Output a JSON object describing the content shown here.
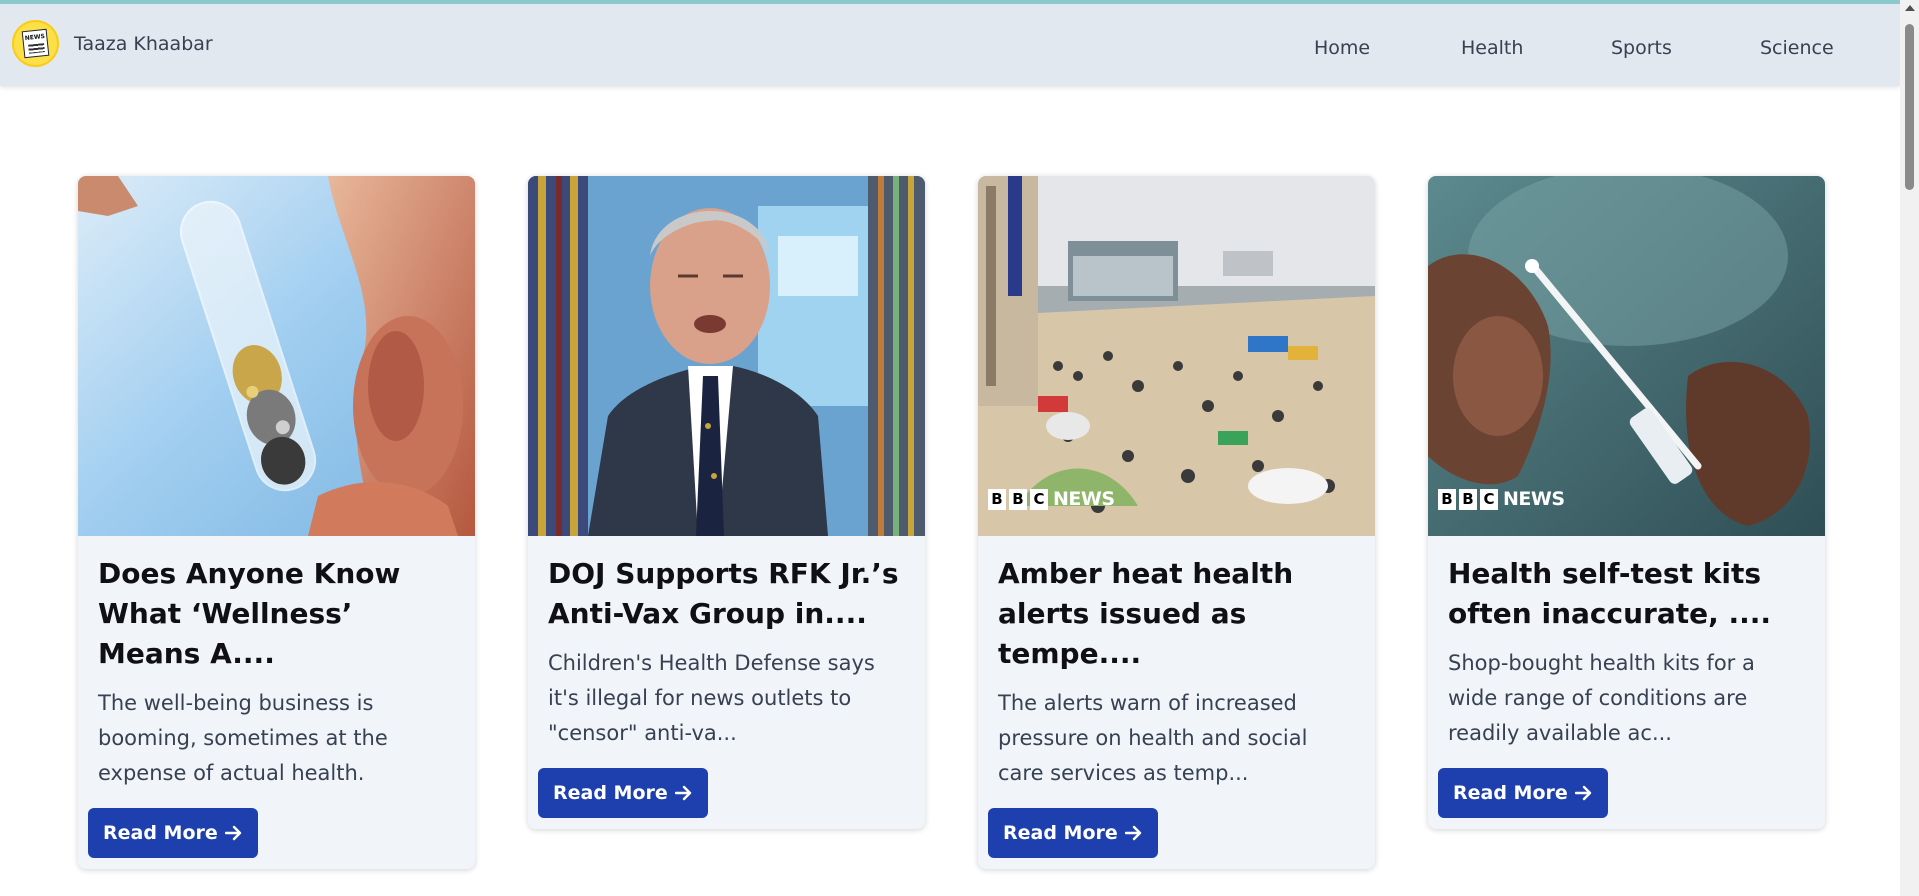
{
  "app": {
    "brand_name": "Taaza Khaabar",
    "logo_text": "NEWS"
  },
  "nav": {
    "items": [
      {
        "label": "Home"
      },
      {
        "label": "Health"
      },
      {
        "label": "Sports"
      },
      {
        "label": "Science"
      }
    ]
  },
  "articles": [
    {
      "title": "Does Anyone Know What ‘Wellness’ Means A....",
      "description": "The well-being business is booming, sometimes at the expense of actual health.",
      "button_label": "Read More",
      "image": "test-tube-with-minerals-near-face",
      "watermark": ""
    },
    {
      "title": "DOJ Supports RFK Jr.’s Anti-Vax Group in....",
      "description": "Children's Health Defense says it's illegal for news outlets to \"censor\" anti-va...",
      "button_label": "Read More",
      "image": "man-in-suit-speaking",
      "watermark": ""
    },
    {
      "title": "Amber heat health alerts issued as tempe....",
      "description": "The alerts warn of increased pressure on health and social care services as temp...",
      "button_label": "Read More",
      "image": "crowded-beach",
      "watermark": {
        "b1": "B",
        "b2": "B",
        "b3": "C",
        "news": "NEWS"
      }
    },
    {
      "title": "Health self-test kits often inaccurate, ....",
      "description": "Shop-bought health kits for a wide range of conditions are readily available ac...",
      "button_label": "Read More",
      "image": "hands-holding-test-swab",
      "watermark": {
        "b1": "B",
        "b2": "B",
        "b3": "C",
        "news": "NEWS"
      }
    }
  ],
  "colors": {
    "navbar_bg": "#e2e8f0",
    "card_bg": "#f1f5f9",
    "button_bg": "#1e40af",
    "button_text": "#ffffff"
  },
  "icons": {
    "brand": "news-logo-icon",
    "button": "arrow-right-icon"
  }
}
